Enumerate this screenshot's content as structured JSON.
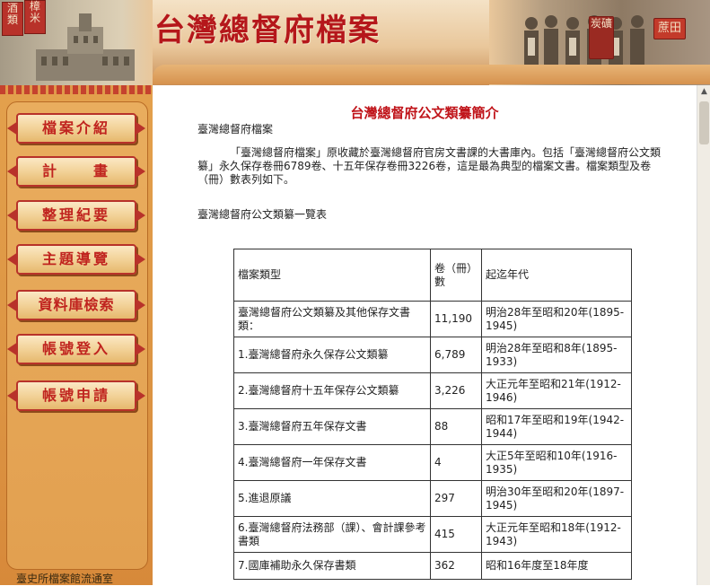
{
  "header": {
    "site_title": "台灣總督府檔案",
    "seal_left_1": "酒類",
    "seal_left_2": "樟米",
    "seal_right_1": "炭礦",
    "seal_right_2": "蔗田"
  },
  "sidebar": {
    "items": [
      {
        "label": "檔案介紹"
      },
      {
        "label": "計　　畫"
      },
      {
        "label": "整理紀要"
      },
      {
        "label": "主題導覽"
      },
      {
        "label": "資料庫檢索"
      },
      {
        "label": "帳號登入"
      },
      {
        "label": "帳號申請"
      }
    ],
    "footer": "臺史所檔案館流通室"
  },
  "main": {
    "title": "台灣總督府公文類纂簡介",
    "intro_heading": "臺灣總督府檔案",
    "intro_paragraph": "「臺灣總督府檔案」原收藏於臺灣總督府官房文書課的大書庫內。包括「臺灣總督府公文類纂」永久保存卷冊6789卷、十五年保存卷冊3226卷，這是最為典型的檔案文書。檔案類型及卷（冊）數表列如下。",
    "list_heading": "臺灣總督府公文類纂一覽表",
    "table": {
      "headers": [
        "檔案類型",
        "卷（冊）數",
        "起迄年代"
      ],
      "rows": [
        [
          "臺灣總督府公文類纂及其他保存文書類：",
          "11,190",
          "明治28年至昭和20年(1895-1945)"
        ],
        [
          "1.臺灣總督府永久保存公文類纂",
          "6,789",
          "明治28年至昭和8年(1895-1933)"
        ],
        [
          "2.臺灣總督府十五年保存公文類纂",
          "3,226",
          "大正元年至昭和21年(1912-1946)"
        ],
        [
          "3.臺灣總督府五年保存文書",
          "88",
          "昭和17年至昭和19年(1942-1944)"
        ],
        [
          "4.臺灣總督府一年保存文書",
          "4",
          "大正5年至昭和10年(1916-1935)"
        ],
        [
          "5.進退原議",
          "297",
          "明治30年至昭和20年(1897-1945)"
        ],
        [
          "6.臺灣總督府法務部（課）、會計課參考書類",
          "415",
          "大正元年至昭和18年(1912-1943)"
        ],
        [
          "7.國庫補助永久保存書類",
          "362",
          "昭和16年度至18年度"
        ]
      ]
    }
  },
  "colors": {
    "accent_red": "#c0141a",
    "sidebar_orange": "#e09a4a",
    "button_border": "#b8322a"
  }
}
